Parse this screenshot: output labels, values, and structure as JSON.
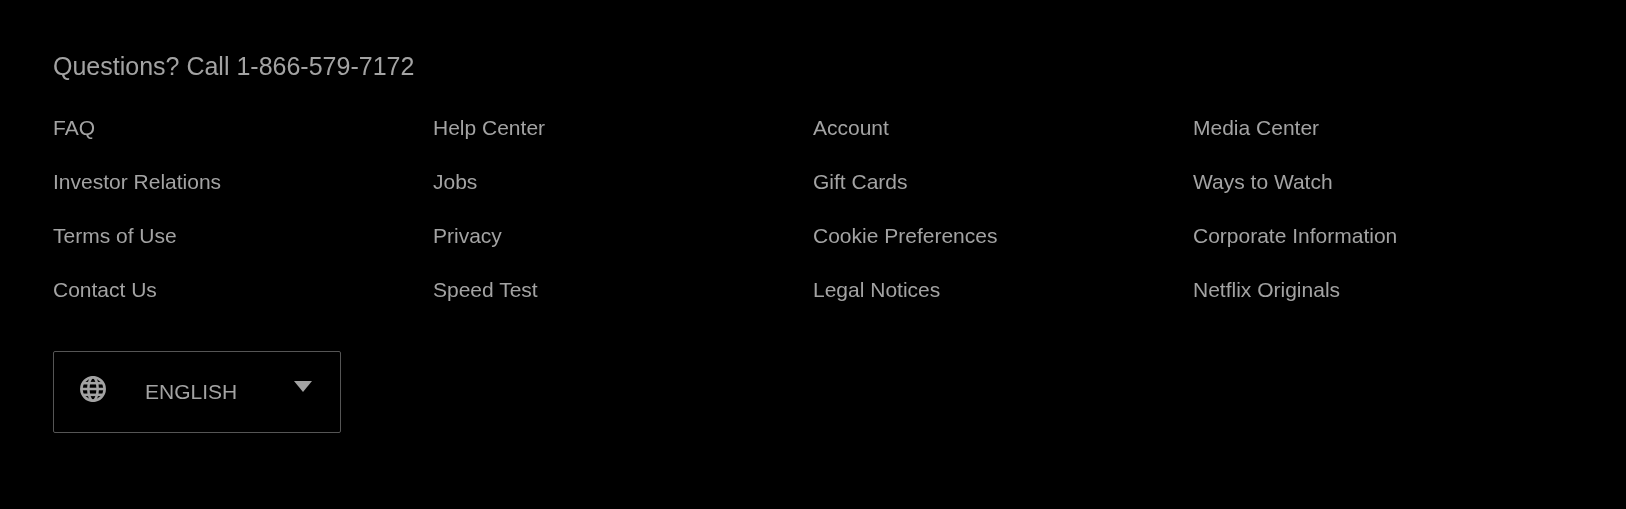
{
  "contact": {
    "text": "Questions? Call 1-866-579-7172"
  },
  "links": [
    "FAQ",
    "Help Center",
    "Account",
    "Media Center",
    "Investor Relations",
    "Jobs",
    "Gift Cards",
    "Ways to Watch",
    "Terms of Use",
    "Privacy",
    "Cookie Preferences",
    "Corporate Information",
    "Contact Us",
    "Speed Test",
    "Legal Notices",
    "Netflix Originals"
  ],
  "language_select": {
    "value": "ENGLISH"
  }
}
